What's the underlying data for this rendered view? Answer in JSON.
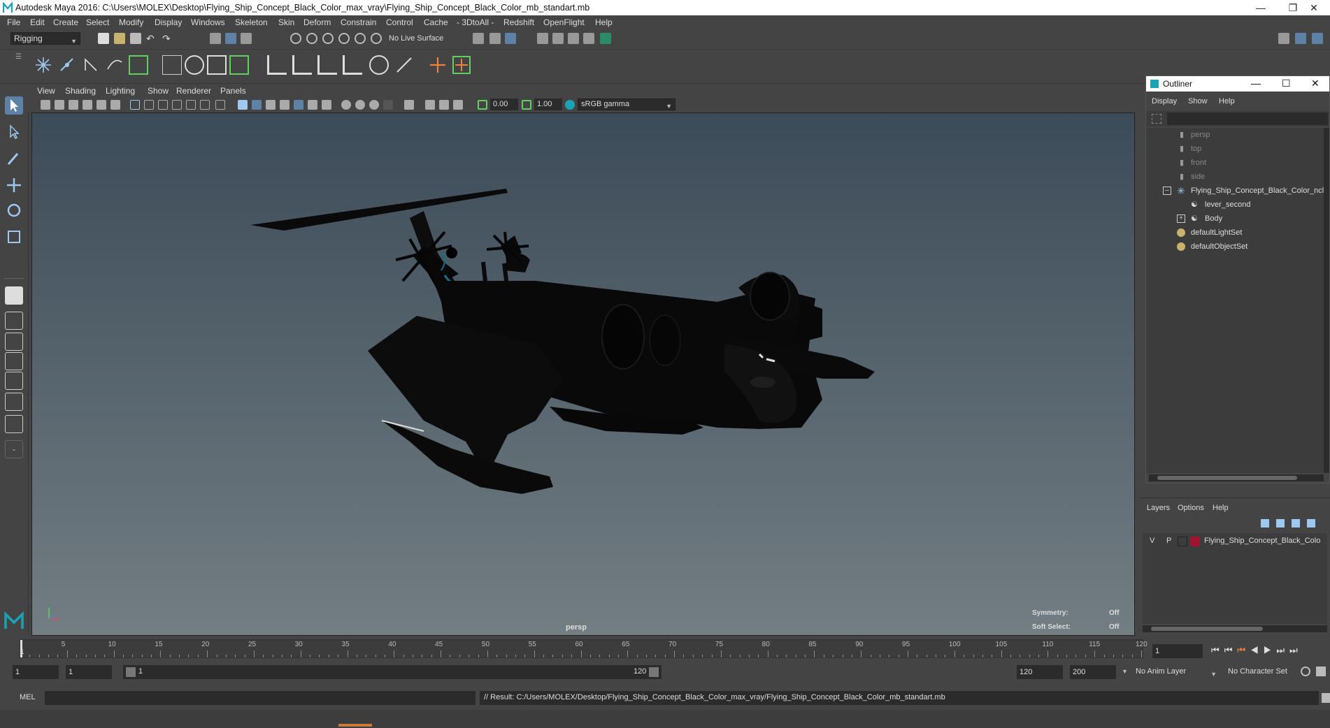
{
  "window": {
    "title": "Autodesk Maya 2016: C:\\Users\\MOLEX\\Desktop\\Flying_Ship_Concept_Black_Color_max_vray\\Flying_Ship_Concept_Black_Color_mb_standart.mb"
  },
  "menubar": [
    "File",
    "Edit",
    "Create",
    "Select",
    "Modify",
    "Display",
    "Windows",
    "Skeleton",
    "Skin",
    "Deform",
    "Constrain",
    "Control",
    "Cache",
    "- 3DtoAll -",
    "Redshift",
    "OpenFlight",
    "Help"
  ],
  "statusline": {
    "mode": "Rigging",
    "live_surface": "No Live Surface"
  },
  "panel": {
    "menus": [
      "View",
      "Shading",
      "Lighting",
      "Show",
      "Renderer",
      "Panels"
    ],
    "exposure": "0.00",
    "gamma": "1.00",
    "colorspace": "sRGB gamma"
  },
  "viewport": {
    "camera_label": "persp",
    "symmetry_label": "Symmetry:",
    "symmetry_value": "Off",
    "soft_select_label": "Soft Select:",
    "soft_select_value": "Off"
  },
  "outliner": {
    "title": "Outliner",
    "menus": [
      "Display",
      "Show",
      "Help"
    ],
    "items": [
      {
        "label": "persp",
        "type": "camera",
        "dim": true
      },
      {
        "label": "top",
        "type": "camera",
        "dim": true
      },
      {
        "label": "front",
        "type": "camera",
        "dim": true
      },
      {
        "label": "side",
        "type": "camera",
        "dim": true
      },
      {
        "label": "Flying_Ship_Concept_Black_Color_ncl",
        "type": "group",
        "expanded": true
      },
      {
        "label": "lever_second",
        "type": "mesh"
      },
      {
        "label": "Body",
        "type": "mesh",
        "collapsed": true
      },
      {
        "label": "defaultLightSet",
        "type": "set"
      },
      {
        "label": "defaultObjectSet",
        "type": "set"
      }
    ]
  },
  "layers": {
    "menus": [
      "Layers",
      "Options",
      "Help"
    ],
    "row": {
      "v": "V",
      "p": "P",
      "name": "Flying_Ship_Concept_Black_Colo",
      "color": "#a0132f"
    }
  },
  "timeline": {
    "ticks": [
      "5",
      "10",
      "15",
      "20",
      "25",
      "30",
      "35",
      "40",
      "45",
      "50",
      "55",
      "60",
      "65",
      "70",
      "75",
      "80",
      "85",
      "90",
      "95",
      "100",
      "105",
      "110",
      "115",
      "120"
    ],
    "start_marker": "1",
    "current_frame": "1"
  },
  "range": {
    "start": "1",
    "start_inner": "1",
    "range_start": "1",
    "range_end": "120",
    "end": "120",
    "total_end": "200",
    "anim_layer": "No Anim Layer",
    "char_set": "No Character Set"
  },
  "command": {
    "lang": "MEL",
    "result": "// Result: C:/Users/MOLEX/Desktop/Flying_Ship_Concept_Black_Color_max_vray/Flying_Ship_Concept_Black_Color_mb_standart.mb"
  },
  "colors": {
    "accent": "#5d82a6",
    "bg": "#444444",
    "layer_color": "#a0132f"
  }
}
